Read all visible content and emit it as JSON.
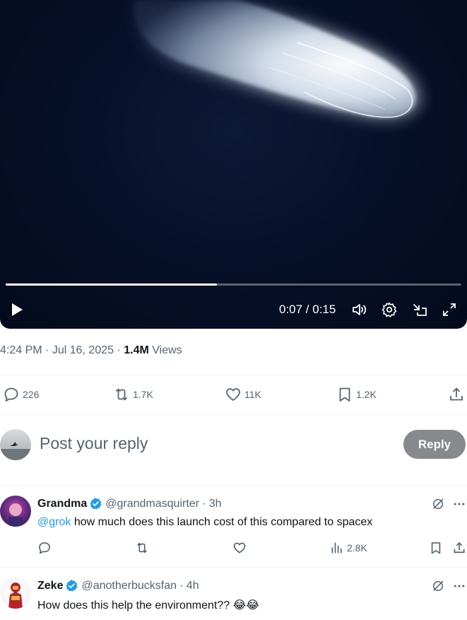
{
  "video": {
    "time_display": "0:07 / 0:15",
    "progress": 0.464,
    "controls": [
      "play-icon",
      "volume-icon",
      "settings-icon",
      "dock-icon",
      "fullscreen-icon"
    ]
  },
  "post": {
    "time": "4:24 PM",
    "date": "Jul 16, 2025",
    "views_count": "1.4M",
    "views_label": "Views",
    "replies": "226",
    "reposts": "1.7K",
    "likes": "11K",
    "bookmarks": "1.2K"
  },
  "composer": {
    "placeholder": "Post your reply",
    "button_label": "Reply"
  },
  "comments": [
    {
      "name": "Grandma",
      "handle": "@grandmasquirter",
      "age": "· 3h",
      "mention": "@grok",
      "text": " how much does this launch cost of this compared to spacex",
      "views": "2.8K"
    },
    {
      "name": "Zeke",
      "handle": "@anotherbucksfan",
      "age": "· 4h",
      "text": "How does this help the environment?? 😂😂"
    }
  ],
  "colors": {
    "accent": "#1d9bf0",
    "muted": "#536471",
    "reply_button": "#87898c"
  }
}
